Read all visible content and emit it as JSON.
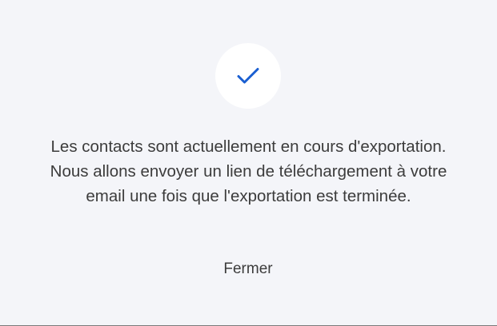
{
  "dialog": {
    "icon": "check-icon",
    "accent_color": "#1a5fd1",
    "message": "Les contacts sont actuellement en cours d'exportation. Nous allons envoyer un lien de téléchargement à votre email une fois que l'exportation est terminée.",
    "close_label": "Fermer"
  }
}
